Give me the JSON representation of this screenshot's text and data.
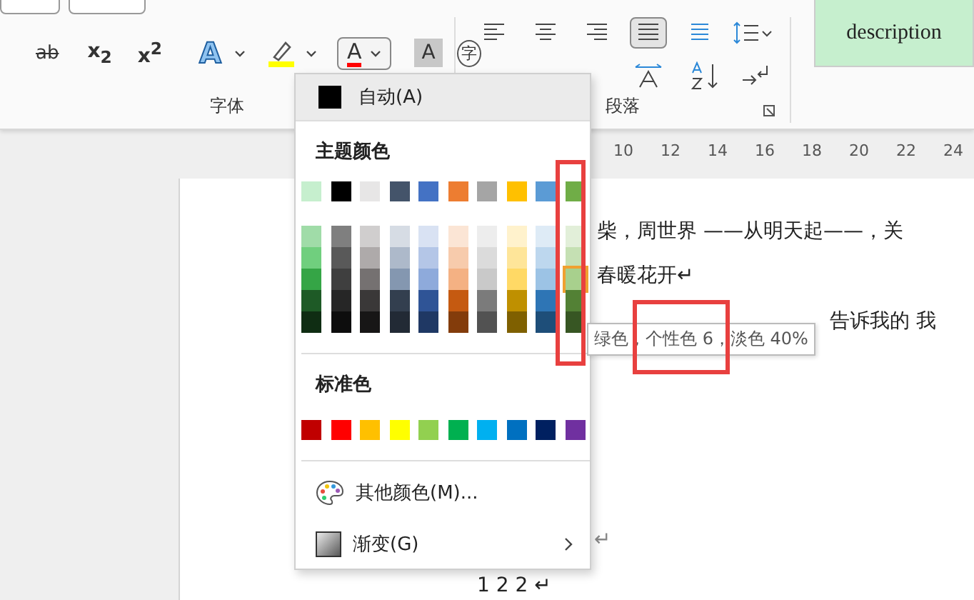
{
  "ribbon": {
    "font_tools": [
      {
        "kind": "strike",
        "glyph": "ab"
      },
      {
        "kind": "script",
        "glyph": "x$_{2}$"
      },
      {
        "kind": "script",
        "glyph": "x$^{2}$"
      },
      {
        "kind": "effect",
        "glyph": "A"
      },
      {
        "kind": "highlight"
      },
      {
        "kind": "fontcolor",
        "glyph": "A"
      },
      {
        "kind": "shade",
        "glyph": "A"
      },
      {
        "kind": "enclose",
        "glyph": "字"
      }
    ],
    "font_label": "字体",
    "alignment": [
      {
        "selected": false
      },
      {
        "selected": false
      },
      {
        "selected": false
      },
      {
        "selected": true
      },
      {
        "selected": false
      }
    ],
    "paragraph_label": "段落",
    "style_item": "description"
  },
  "ruler": [
    "10",
    "12",
    "14",
    "16",
    "18",
    "20",
    "22",
    "24"
  ],
  "document": {
    "lines": [
      "柴，周世界 ——从明天起——，关",
      "春暖花开↵",
      "告诉我的 我"
    ],
    "return_mark": "↵",
    "page_number": "1 2 2 ↵"
  },
  "color_menu": {
    "automatic": {
      "label": "自动(A)",
      "color": "#000000"
    },
    "theme_header": "主题颜色",
    "theme_colors": [
      {
        "color": "#c6efce",
        "selected": false,
        "shades": [
          {
            "color": "#a0dca8",
            "selected": false
          },
          {
            "color": "#70cf7e",
            "selected": false
          },
          {
            "color": "#35a546",
            "selected": false
          },
          {
            "color": "#1e5a26",
            "selected": false
          },
          {
            "color": "#0f2d13",
            "selected": false
          }
        ]
      },
      {
        "color": "#000000",
        "selected": false,
        "shades": [
          {
            "color": "#7f7f7f",
            "selected": false
          },
          {
            "color": "#595959",
            "selected": false
          },
          {
            "color": "#3f3f3f",
            "selected": false
          },
          {
            "color": "#262626",
            "selected": false
          },
          {
            "color": "#0d0d0d",
            "selected": false
          }
        ]
      },
      {
        "color": "#e7e6e6",
        "selected": false,
        "shades": [
          {
            "color": "#d0cece",
            "selected": false
          },
          {
            "color": "#aeaaaa",
            "selected": false
          },
          {
            "color": "#757171",
            "selected": false
          },
          {
            "color": "#3a3838",
            "selected": false
          },
          {
            "color": "#171616",
            "selected": false
          }
        ]
      },
      {
        "color": "#44546a",
        "selected": false,
        "shades": [
          {
            "color": "#d6dce4",
            "selected": false
          },
          {
            "color": "#adb9ca",
            "selected": false
          },
          {
            "color": "#8497b0",
            "selected": false
          },
          {
            "color": "#333f4f",
            "selected": false
          },
          {
            "color": "#222a35",
            "selected": false
          }
        ]
      },
      {
        "color": "#4472c4",
        "selected": false,
        "shades": [
          {
            "color": "#d9e2f3",
            "selected": false
          },
          {
            "color": "#b4c6e7",
            "selected": false
          },
          {
            "color": "#8eaadb",
            "selected": false
          },
          {
            "color": "#2f5496",
            "selected": false
          },
          {
            "color": "#1f3864",
            "selected": false
          }
        ]
      },
      {
        "color": "#ed7d31",
        "selected": false,
        "shades": [
          {
            "color": "#fbe5d5",
            "selected": false
          },
          {
            "color": "#f7cbac",
            "selected": false
          },
          {
            "color": "#f4b183",
            "selected": false
          },
          {
            "color": "#c55a11",
            "selected": false
          },
          {
            "color": "#833c0b",
            "selected": false
          }
        ]
      },
      {
        "color": "#a5a5a5",
        "selected": false,
        "shades": [
          {
            "color": "#ededed",
            "selected": false
          },
          {
            "color": "#dbdbdb",
            "selected": false
          },
          {
            "color": "#c9c9c9",
            "selected": false
          },
          {
            "color": "#7b7b7b",
            "selected": false
          },
          {
            "color": "#525252",
            "selected": false
          }
        ]
      },
      {
        "color": "#ffc000",
        "selected": false,
        "shades": [
          {
            "color": "#fff2cc",
            "selected": false
          },
          {
            "color": "#fee599",
            "selected": false
          },
          {
            "color": "#ffd965",
            "selected": false
          },
          {
            "color": "#bf9000",
            "selected": false
          },
          {
            "color": "#7f6000",
            "selected": false
          }
        ]
      },
      {
        "color": "#5b9bd5",
        "selected": false,
        "shades": [
          {
            "color": "#deebf6",
            "selected": false
          },
          {
            "color": "#bdd7ee",
            "selected": false
          },
          {
            "color": "#9cc3e5",
            "selected": false
          },
          {
            "color": "#2e75b5",
            "selected": false
          },
          {
            "color": "#1e4e79",
            "selected": false
          }
        ]
      },
      {
        "color": "#70ad47",
        "selected": false,
        "shades": [
          {
            "color": "#e2efd9",
            "selected": false
          },
          {
            "color": "#c5e0b3",
            "selected": false
          },
          {
            "color": "#a8d08d",
            "selected": true
          },
          {
            "color": "#538135",
            "selected": false
          },
          {
            "color": "#375623",
            "selected": false
          }
        ]
      }
    ],
    "standard_header": "标准色",
    "standard_colors": [
      {
        "color": "#c00000",
        "selected": false
      },
      {
        "color": "#ff0000",
        "selected": false
      },
      {
        "color": "#ffc000",
        "selected": false
      },
      {
        "color": "#ffff00",
        "selected": false
      },
      {
        "color": "#92d050",
        "selected": false
      },
      {
        "color": "#00b050",
        "selected": false
      },
      {
        "color": "#00b0f0",
        "selected": false
      },
      {
        "color": "#0070c0",
        "selected": false
      },
      {
        "color": "#002060",
        "selected": false
      },
      {
        "color": "#7030a0",
        "selected": false
      }
    ],
    "more_colors": "其他颜色(M)...",
    "gradient": "渐变(G)"
  },
  "tooltip": "绿色，个性色 6，淡色 40%"
}
